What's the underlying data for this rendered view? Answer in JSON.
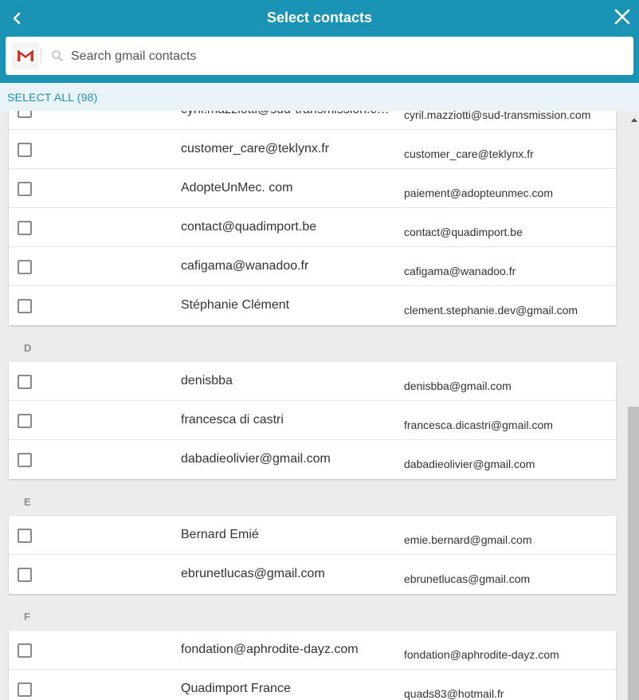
{
  "header": {
    "title": "Select contacts",
    "back_icon": "chevron-left-icon",
    "close_icon": "close-icon"
  },
  "search": {
    "placeholder": "Search gmail contacts",
    "value": "",
    "provider_icon": "gmail-icon"
  },
  "select_all_label": "SELECT ALL (98)",
  "colors": {
    "accent": "#1a93b5",
    "background": "#ececec",
    "text": "#333333"
  },
  "sections": [
    {
      "letter": "",
      "contacts": [
        {
          "name": "cyril.mazziotti@sud-transmission.com",
          "email": "cyril.mazziotti@sud-transmission.com"
        },
        {
          "name": "customer_care@teklynx.fr",
          "email": "customer_care@teklynx.fr"
        },
        {
          "name": "AdopteUnMec. com",
          "email": "paiement@adopteunmec.com"
        },
        {
          "name": "contact@quadimport.be",
          "email": "contact@quadimport.be"
        },
        {
          "name": "cafigama@wanadoo.fr",
          "email": "cafigama@wanadoo.fr"
        },
        {
          "name": "Stéphanie Clément",
          "email": "clement.stephanie.dev@gmail.com"
        }
      ]
    },
    {
      "letter": "D",
      "contacts": [
        {
          "name": "denisbba",
          "email": "denisbba@gmail.com"
        },
        {
          "name": "francesca di castri",
          "email": "francesca.dicastri@gmail.com"
        },
        {
          "name": "dabadieolivier@gmail.com",
          "email": "dabadieolivier@gmail.com"
        }
      ]
    },
    {
      "letter": "E",
      "contacts": [
        {
          "name": "Bernard Emié",
          "email": "emie.bernard@gmail.com"
        },
        {
          "name": "ebrunetlucas@gmail.com",
          "email": "ebrunetlucas@gmail.com"
        }
      ]
    },
    {
      "letter": "F",
      "contacts": [
        {
          "name": "fondation@aphrodite-dayz.com",
          "email": "fondation@aphrodite-dayz.com"
        },
        {
          "name": "Quadimport France",
          "email": "quads83@hotmail.fr"
        }
      ]
    }
  ]
}
